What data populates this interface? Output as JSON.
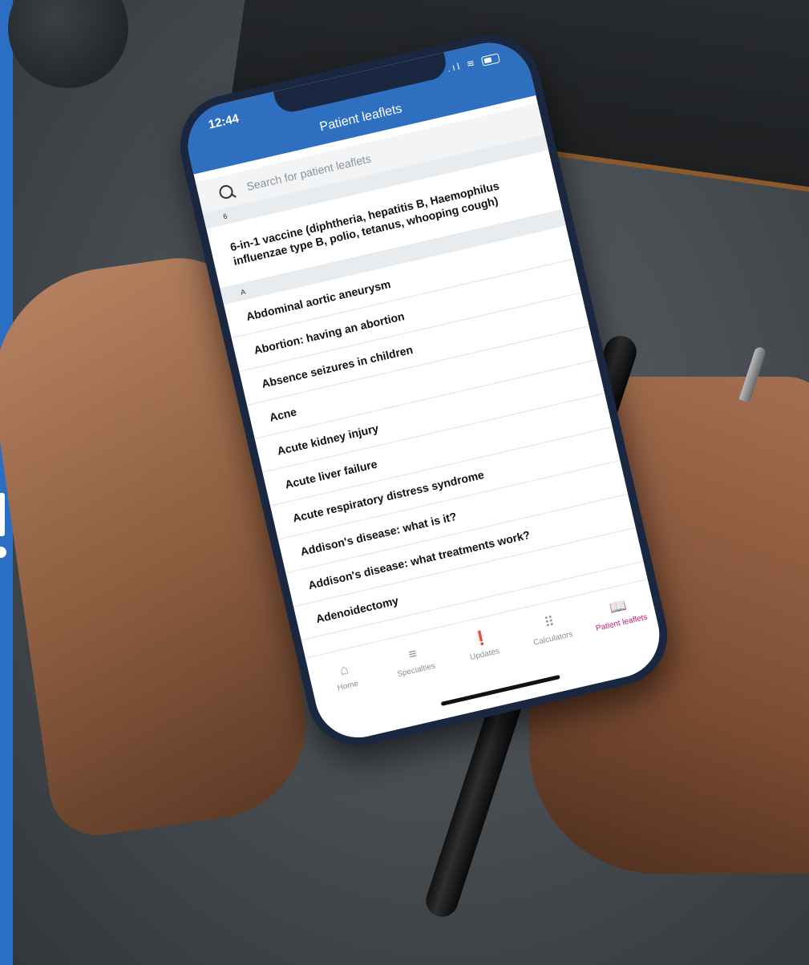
{
  "status": {
    "time": "12:44"
  },
  "header": {
    "title": "Patient leaflets"
  },
  "search": {
    "placeholder": "Search for patient leaflets"
  },
  "sections": [
    {
      "letter": "6",
      "items": [
        "6-in-1 vaccine (diphtheria, hepatitis B, Haemophilus influenzae type B, polio, tetanus, whooping cough)"
      ]
    },
    {
      "letter": "A",
      "items": [
        "Abdominal aortic aneurysm",
        "Abortion: having an abortion",
        "Absence seizures in children",
        "Acne",
        "Acute kidney injury",
        "Acute liver failure",
        "Acute respiratory distress syndrome",
        "Addison's disease: what is it?",
        "Addison's disease: what treatments work?",
        "Adenoidectomy"
      ]
    }
  ],
  "tabs": [
    {
      "label": "Home",
      "icon": "home-icon",
      "active": false
    },
    {
      "label": "Specialties",
      "icon": "list-icon",
      "active": false
    },
    {
      "label": "Updates",
      "icon": "alert-icon",
      "active": false
    },
    {
      "label": "Calculators",
      "icon": "keypad-icon",
      "active": false
    },
    {
      "label": "Patient leaflets",
      "icon": "leaflet-icon",
      "active": true
    }
  ],
  "colors": {
    "brand": "#2e6fc0",
    "active_tab": "#c1207e"
  }
}
